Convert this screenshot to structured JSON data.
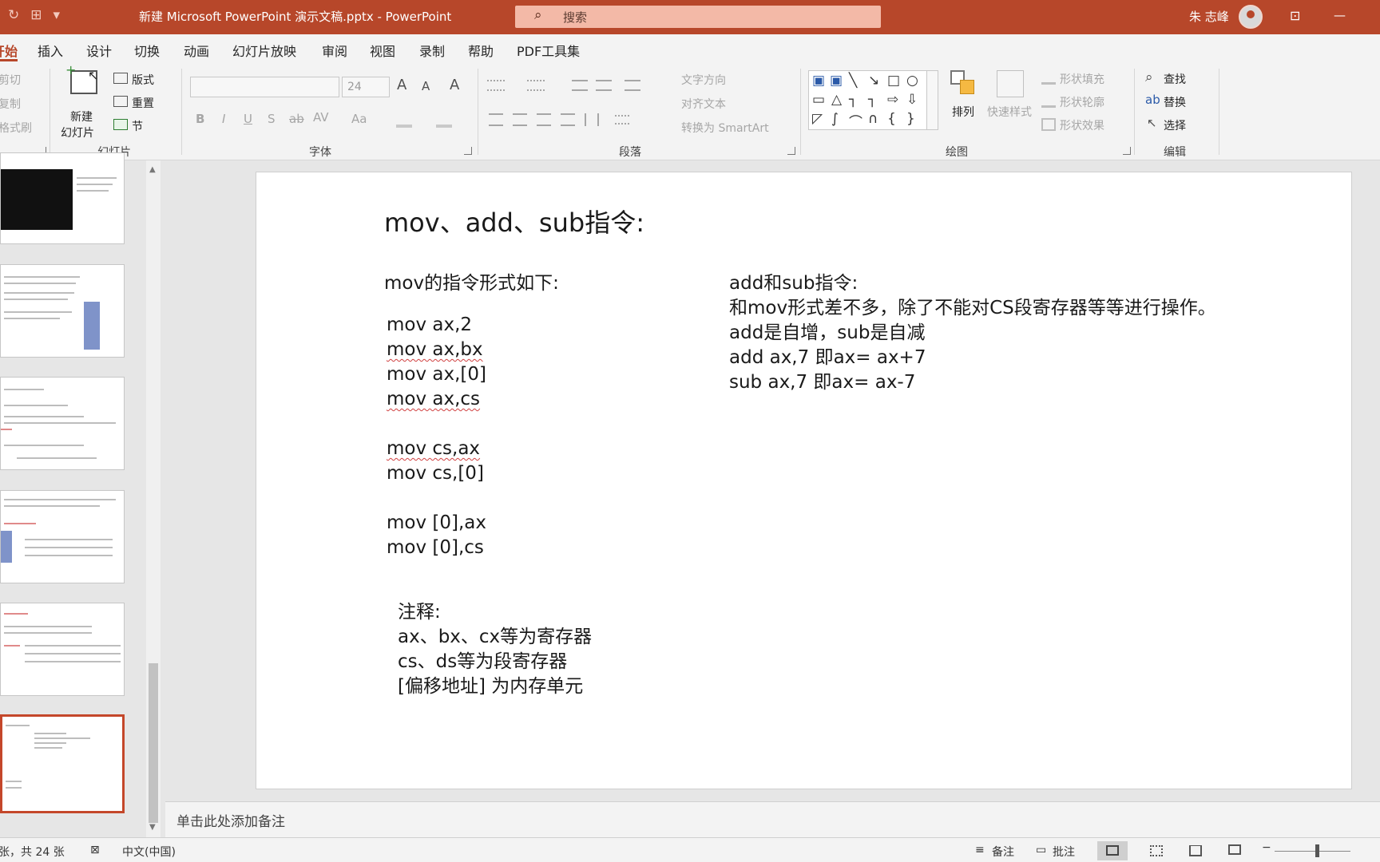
{
  "titlebar": {
    "doc_title": "新建 Microsoft PowerPoint 演示文稿.pptx  -  PowerPoint",
    "search_placeholder": "搜索",
    "user_name": "朱 志峰",
    "undo_glyph": "↻",
    "pin_glyph": "⊞",
    "more_glyph": "▾",
    "search_glyph": "⌕",
    "restore_glyph": "⊡",
    "minimize_glyph": "—"
  },
  "tabs": [
    {
      "label": "开始",
      "active": true
    },
    {
      "label": "插入"
    },
    {
      "label": "设计"
    },
    {
      "label": "切换"
    },
    {
      "label": "动画"
    },
    {
      "label": "幻灯片放映"
    },
    {
      "label": "审阅"
    },
    {
      "label": "视图"
    },
    {
      "label": "录制"
    },
    {
      "label": "帮助"
    },
    {
      "label": "PDF工具集"
    }
  ],
  "ribbon": {
    "clipboard": {
      "cut": "剪切",
      "copy": "复制",
      "painter": "格式刷"
    },
    "slides": {
      "new_slide": "新建",
      "new_slide2": "幻灯片",
      "layout": "版式",
      "reset": "重置",
      "section": "节",
      "group_label": "幻灯片"
    },
    "font": {
      "font_name": "",
      "font_size": "24",
      "grow": "A",
      "shrink": "A",
      "clear": "A",
      "bold": "B",
      "italic": "I",
      "underline": "U",
      "shadow": "S",
      "strike": "ab",
      "spacing": "AV",
      "case": "Aa",
      "group_label": "字体"
    },
    "paragraph": {
      "text_direction": "文字方向",
      "align_text": "对齐文本",
      "smartart": "转换为 SmartArt",
      "group_label": "段落"
    },
    "drawing": {
      "arrange": "排列",
      "quick_styles": "快速样式",
      "shape_fill": "形状填充",
      "shape_outline": "形状轮廓",
      "shape_effects": "形状效果",
      "group_label": "绘图"
    },
    "editing": {
      "find": "查找",
      "replace": "替换",
      "select": "选择",
      "group_label": "编辑"
    }
  },
  "slide": {
    "title": "mov、add、sub指令:",
    "left_heading": "mov的指令形式如下:",
    "mov_lines": [
      "mov ax,2",
      "mov ax,bx",
      "mov ax,[0]",
      "mov ax,cs",
      "mov cs,ax",
      "mov cs,[0]",
      "mov [0],ax",
      "mov [0],cs"
    ],
    "notes_lines": [
      "注释:",
      "ax、bx、cx等为寄存器",
      "cs、ds等为段寄存器",
      "[偏移地址] 为内存单元"
    ],
    "right_lines": [
      "add和sub指令:",
      "和mov形式差不多，除了不能对CS段寄存器等等进行操作。",
      "add是自增，sub是自减",
      "add ax,7 即ax= ax+7",
      "sub ax,7 即ax= ax-7"
    ]
  },
  "notes_placeholder": "单击此处添加备注",
  "status": {
    "slide_count": "张，共 24 张",
    "language": "中文(中国)",
    "notes": "备注",
    "comments": "批注"
  }
}
